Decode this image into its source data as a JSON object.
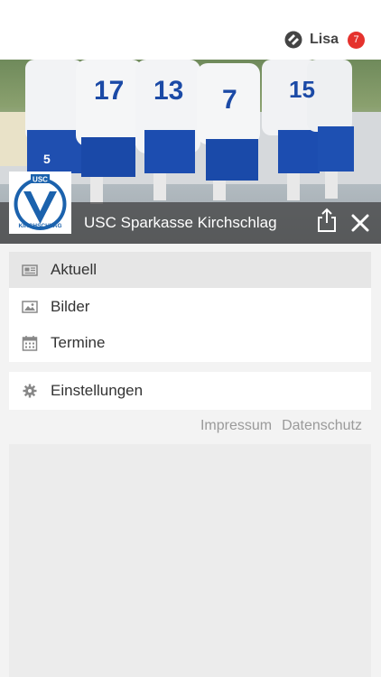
{
  "user": {
    "name": "Lisa",
    "notifications": "7",
    "icon": "app-logo-icon"
  },
  "club": {
    "name": "USC Sparkasse Kirchschlag",
    "logo_text_top": "USC",
    "logo_text_bottom": "KIRCHSCHLAG"
  },
  "hero": {
    "jerseys": [
      "17",
      "13",
      "7",
      "15",
      "5"
    ],
    "description": "team photo"
  },
  "actions": {
    "share": "share-icon",
    "close": "close-icon"
  },
  "menu_main": [
    {
      "label": "Aktuell",
      "icon": "newspaper-icon",
      "active": true
    },
    {
      "label": "Bilder",
      "icon": "image-icon",
      "active": false
    },
    {
      "label": "Termine",
      "icon": "calendar-icon",
      "active": false
    }
  ],
  "menu_settings": [
    {
      "label": "Einstellungen",
      "icon": "gear-icon"
    }
  ],
  "footer_links": [
    "Impressum",
    "Datenschutz"
  ],
  "colors": {
    "badge": "#e5322d",
    "club_blue": "#1b62ad",
    "active_item": "#e6e6e6"
  }
}
